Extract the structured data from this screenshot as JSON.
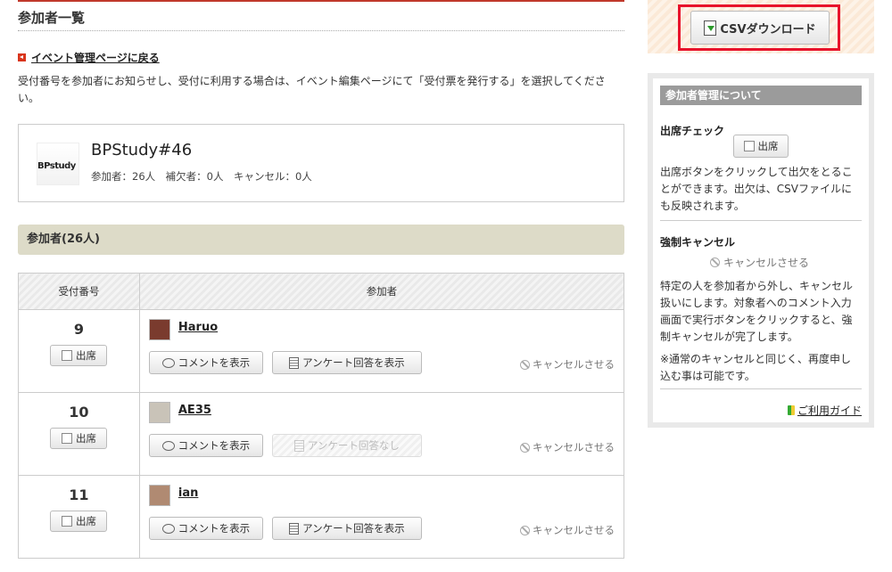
{
  "page": {
    "title": "参加者一覧",
    "back_link": "イベント管理ページに戻る",
    "description": "受付番号を参加者にお知らせし、受付に利用する場合は、イベント編集ページにて「受付票を発行する」を選択してください。"
  },
  "event": {
    "logo_text": "BPstudy",
    "name": "BPStudy#46",
    "stats": "参加者：26人　補欠者：0人　キャンセル：0人"
  },
  "section": {
    "title": "参加者(26人)"
  },
  "table": {
    "headers": [
      "受付番号",
      "参加者"
    ],
    "rows": [
      {
        "number": "9",
        "name": "Haruo",
        "avatar_color": "#7a3b2e",
        "comment": "コメントを表示",
        "survey": "アンケート回答を表示",
        "survey_disabled": false,
        "cancel": "キャンセルさせる",
        "attend": "出席"
      },
      {
        "number": "10",
        "name": "AE35",
        "avatar_color": "#c9c3b8",
        "comment": "コメントを表示",
        "survey": "アンケート回答なし",
        "survey_disabled": true,
        "cancel": "キャンセルさせる",
        "attend": "出席"
      },
      {
        "number": "11",
        "name": "ian",
        "avatar_color": "#b08a72",
        "comment": "コメントを表示",
        "survey": "アンケート回答を表示",
        "survey_disabled": false,
        "cancel": "キャンセルさせる",
        "attend": "出席"
      }
    ]
  },
  "sidebar": {
    "csv_button": "CSVダウンロード",
    "box_title": "参加者管理について",
    "attendance_title": "出席チェック",
    "attend_button": "出席",
    "attendance_text": "出席ボタンをクリックして出欠をとることができます。出欠は、CSVファイルにも反映されます。",
    "cancel_title": "強制キャンセル",
    "cancel_button": "キャンセルさせる",
    "cancel_text": "特定の人を参加者から外し、キャンセル扱いにします。対象者へのコメント入力画面で実行ボタンをクリックすると、強制キャンセルが完了します。",
    "note": "※通常のキャンセルと同じく、再度申し込む事は可能です。",
    "guide": "ご利用ガイド"
  },
  "colors": {
    "accent_red": "#e8132b",
    "header_bg": "#dddbc8"
  }
}
